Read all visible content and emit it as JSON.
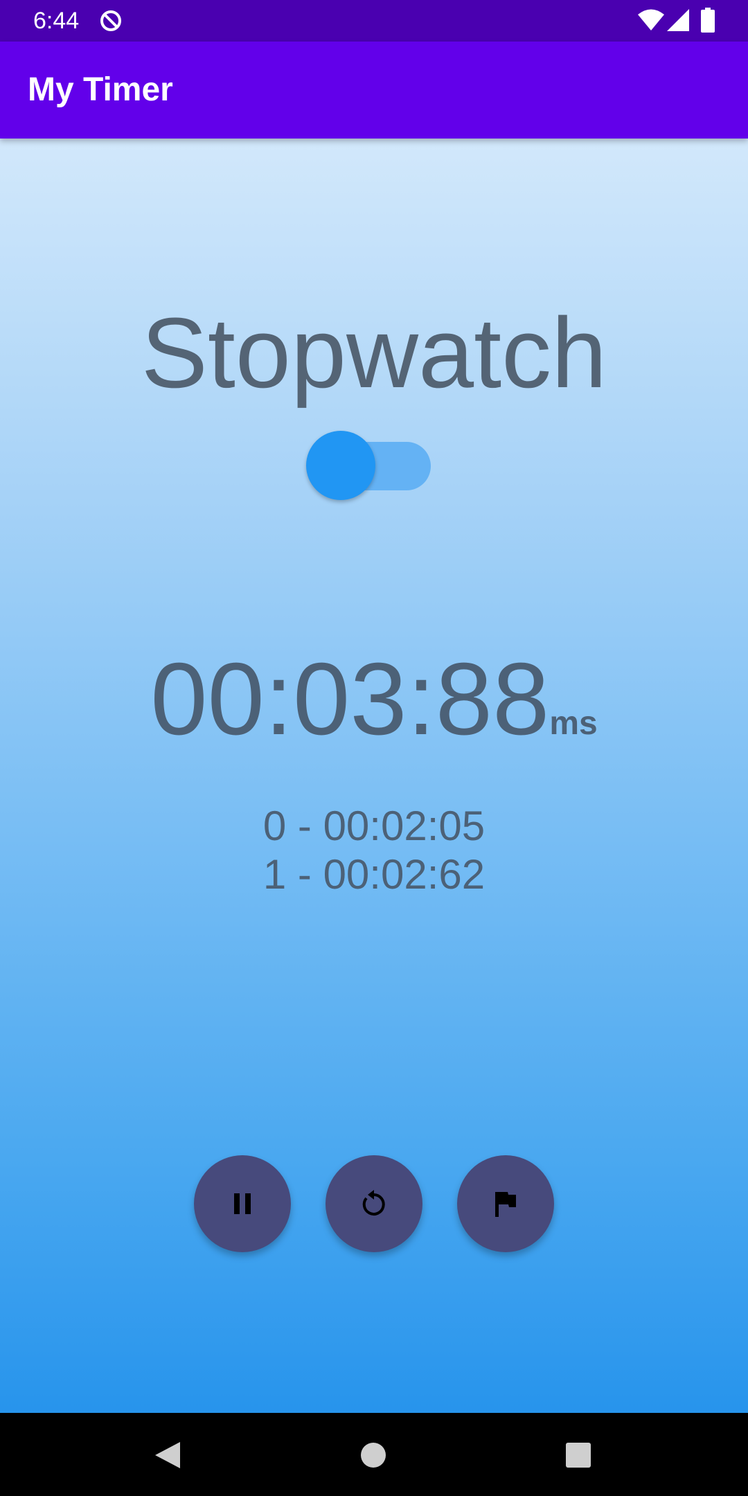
{
  "status_bar": {
    "time": "6:44",
    "icons": [
      "sync-disabled-icon",
      "wifi-icon",
      "signal-icon",
      "battery-icon"
    ]
  },
  "app_bar": {
    "title": "My Timer"
  },
  "main": {
    "mode_label": "Stopwatch",
    "mode_switch_on": false,
    "time": "00:03:88",
    "time_unit": "ms",
    "laps": [
      "0 - 00:02:05",
      "1 - 00:02:62"
    ],
    "buttons": [
      {
        "name": "pause",
        "icon": "pause-icon"
      },
      {
        "name": "reset",
        "icon": "reset-icon"
      },
      {
        "name": "lap",
        "icon": "flag-icon"
      }
    ]
  },
  "nav_bar": {
    "buttons": [
      "back-icon",
      "home-icon",
      "recents-icon"
    ]
  },
  "colors": {
    "status_bar": "#4a00b0",
    "app_bar": "#6200ea",
    "text": "#546475",
    "fab": "#474a7c",
    "switch_thumb": "#2196f3",
    "switch_track": "#64b2f4"
  }
}
